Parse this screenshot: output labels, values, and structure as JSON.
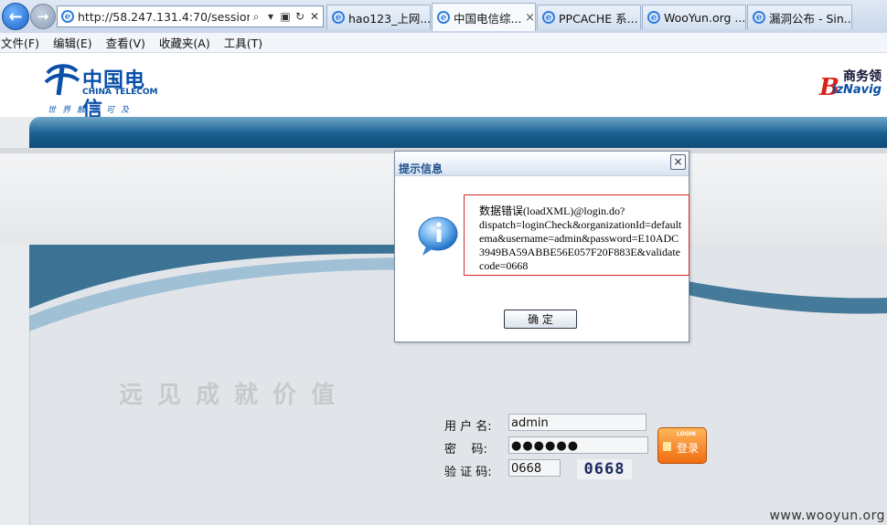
{
  "browser": {
    "address_url": "http://58.247.131.4:70/sessionT",
    "tabs": [
      {
        "label": "hao123_上网...",
        "active": false
      },
      {
        "label": "中国电信综...",
        "active": true
      },
      {
        "label": "PPCACHE 系...",
        "active": false
      },
      {
        "label": "WooYun.org ...",
        "active": false
      },
      {
        "label": "漏洞公布 - Sin...",
        "active": false
      }
    ],
    "active_tab_close": "×",
    "menu": [
      "文件(F)",
      "编辑(E)",
      "查看(V)",
      "收藏夹(A)",
      "工具(T)"
    ]
  },
  "header": {
    "logo_cn": "中国电信",
    "logo_en": "CHINA TELECOM",
    "logo_slogan": "世界触手可及",
    "biz_logo_mark": "B",
    "biz_logo_cn": "商务领",
    "biz_logo_en": "izNavig"
  },
  "slogan": "远见成就价值",
  "login": {
    "username_label": "用 户 名:",
    "username_value": "admin",
    "password_label": "密    码:",
    "password_value": "●●●●●●",
    "captcha_label": "验 证 码:",
    "captcha_value": "0668",
    "captcha_image_text": "0668",
    "login_button_en": "LOGIN",
    "login_button_cn": "登录"
  },
  "dialog": {
    "title": "提示信息",
    "close": "×",
    "message_lines": [
      "数据错误(loadXML)@login.do?",
      "dispatch=loginCheck&organizationId=default",
      "ema&username=admin&password=E10ADC",
      "3949BA59ABBE56E057F20F883E&validate",
      "code=0668"
    ],
    "ok_button": "确 定"
  },
  "watermark": "www.wooyun.org",
  "colors": {
    "brand_blue": "#0a4fa8",
    "band_blue": "#185f90",
    "login_orange": "#f06d10",
    "error_border": "#d42a2a"
  }
}
